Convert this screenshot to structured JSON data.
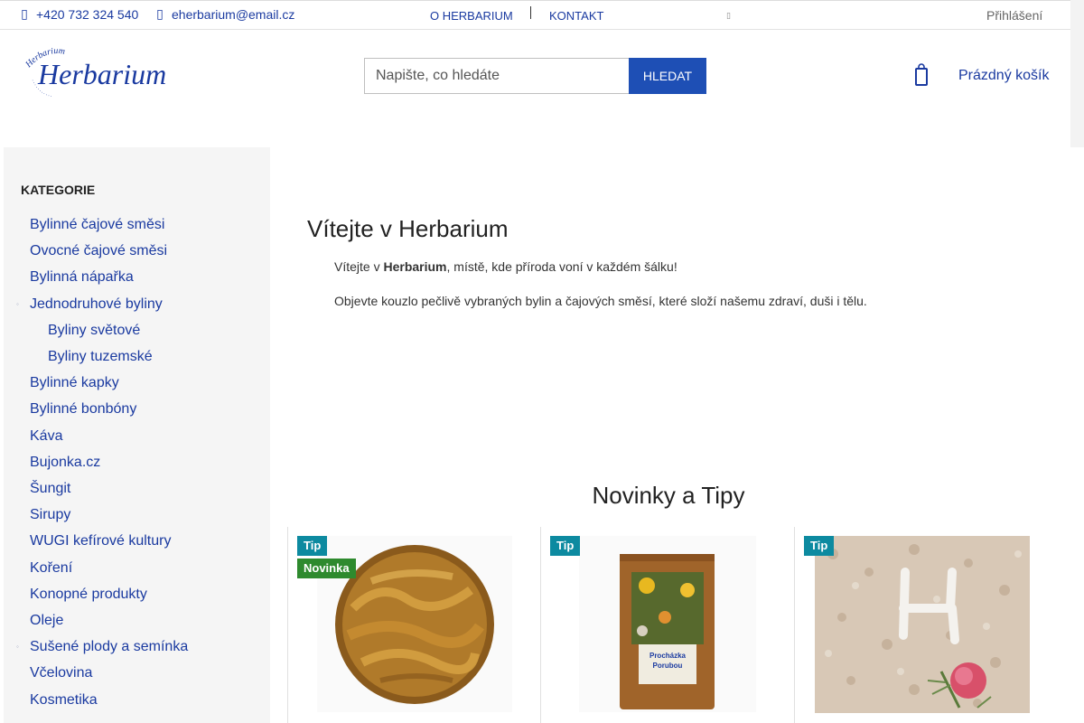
{
  "topbar": {
    "phone": "+420 732 324 540",
    "email": "eherbarium@email.cz",
    "nav": [
      "O HERBARIUM",
      "KONTAKT"
    ],
    "login": "Přihlášení",
    "phone_icon": "phone-icon",
    "email_icon": "envelope-icon"
  },
  "header": {
    "logo_text": "Herbarium",
    "logo_arc_text": "Herbarium",
    "search_placeholder": "Napište, co hledáte",
    "search_button": "HLEDAT",
    "cart_label": "Prázdný košík",
    "cart_icon": "shopping-bag-icon"
  },
  "sidebar": {
    "title": "KATEGORIE",
    "items": [
      {
        "label": "Bylinné čajové směsi",
        "level": 0,
        "has_sub": false
      },
      {
        "label": "Ovocné čajové směsi",
        "level": 0,
        "has_sub": false
      },
      {
        "label": "Bylinná nápařka",
        "level": 0,
        "has_sub": false
      },
      {
        "label": "Jednodruhové byliny",
        "level": 0,
        "has_sub": true
      },
      {
        "label": "Byliny světové",
        "level": 1,
        "has_sub": false
      },
      {
        "label": "Byliny tuzemské",
        "level": 1,
        "has_sub": false
      },
      {
        "label": "Bylinné kapky",
        "level": 0,
        "has_sub": false
      },
      {
        "label": "Bylinné bonbóny",
        "level": 0,
        "has_sub": false
      },
      {
        "label": "Káva",
        "level": 0,
        "has_sub": false
      },
      {
        "label": "Bujonka.cz",
        "level": 0,
        "has_sub": false
      },
      {
        "label": "Šungit",
        "level": 0,
        "has_sub": false
      },
      {
        "label": "Sirupy",
        "level": 0,
        "has_sub": false
      },
      {
        "label": "WUGI kefírové kultury",
        "level": 0,
        "has_sub": false
      },
      {
        "label": "Koření",
        "level": 0,
        "has_sub": false
      },
      {
        "label": "Konopné produkty",
        "level": 0,
        "has_sub": false
      },
      {
        "label": "Oleje",
        "level": 0,
        "has_sub": false
      },
      {
        "label": "Sušené plody a semínka",
        "level": 0,
        "has_sub": true
      },
      {
        "label": "Včelovina",
        "level": 0,
        "has_sub": false
      },
      {
        "label": "Kosmetika",
        "level": 0,
        "has_sub": false
      }
    ]
  },
  "main": {
    "title": "Vítejte v Herbarium",
    "intro_prefix": "Vítejte v ",
    "intro_bold": "Herbarium",
    "intro_suffix": ", místě, kde příroda voní v každém šálku!",
    "intro2": "Objevte kouzlo pečlivě vybraných bylin a čajových směsí, které složí našemu zdraví, duši i tělu.",
    "section_title": "Novinky a Tipy"
  },
  "products": [
    {
      "badges": [
        "Tip",
        "Novinka"
      ],
      "image": "dried-banana-chips"
    },
    {
      "badges": [
        "Tip"
      ],
      "image": "herbal-tea-pouch",
      "pouch_text": "Procházka Poruba"
    },
    {
      "badges": [
        "Tip"
      ],
      "image": "milk-thistle-flakes"
    }
  ],
  "colors": {
    "link": "#1a3aa0",
    "button": "#1e4fb5",
    "badge_tip": "#0d8aa0",
    "badge_new": "#2e8a2e",
    "sidebar_bg": "#f5f5f5"
  }
}
